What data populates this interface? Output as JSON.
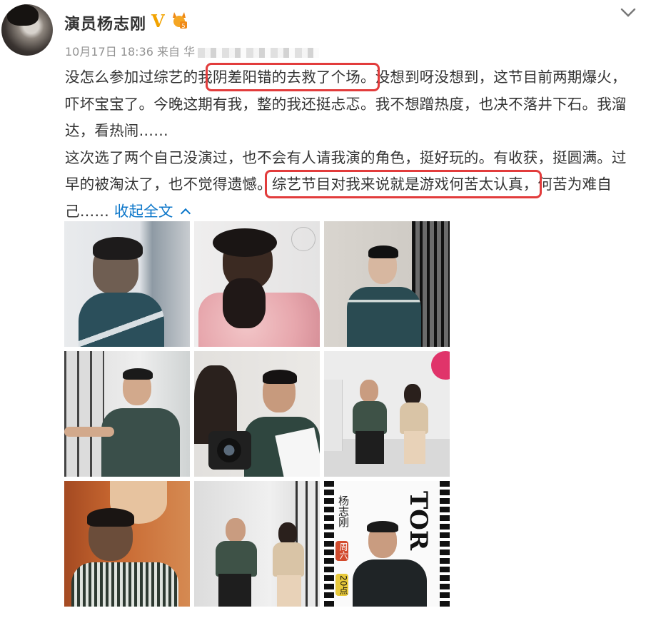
{
  "user": {
    "name": "演员杨志刚",
    "verified_mark": "V"
  },
  "meta": {
    "date": "10月17日 18:36",
    "source_prefix": "来自 华"
  },
  "post": {
    "p1_a": "没怎么参加过综艺的我",
    "p1_hl": "阴差阳错的去救了个场。",
    "p1_b": "没想到呀没想到，这节目前两期爆火，吓坏宝宝了。今晚这期有我，整的我还挺忐忑。我不想蹭热度，也决不落井下石。我溜达，看热闹……",
    "p2_a": "这次选了两个自己没演过，也不会有人请我演的角色，挺好玩的。有收获，挺圆满。过早的被淘汰了，也不觉得遗憾。",
    "p2_hl": "综艺节目对我来说就是游戏何苦太认真，",
    "p2_b": "何苦为难自己……",
    "collapse_label": "收起全文"
  },
  "photos": {
    "p9_vertical_name": "杨志刚",
    "p9_big_letters": "TOR",
    "p9_day": "周六",
    "p9_time": "20点"
  },
  "colors": {
    "highlight_border": "#e23c3c",
    "link": "#0b76c9",
    "verified": "#f2a300",
    "meta_text": "#939393"
  }
}
